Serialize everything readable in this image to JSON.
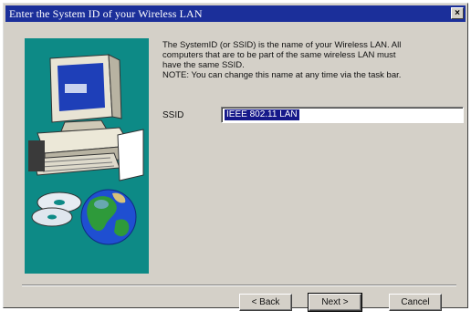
{
  "window": {
    "title": "Enter the System ID of your Wireless LAN",
    "close_label": "×"
  },
  "description": {
    "line1": "The SystemID (or SSID) is the name of your Wireless LAN. All",
    "line2": "computers that are to be part of the same wireless LAN must",
    "line3": "have the same SSID.",
    "line4": "NOTE: You can change this name at any time via the task bar."
  },
  "ssid": {
    "label": "SSID",
    "value": "IEEE 802.11 LAN"
  },
  "buttons": {
    "back": "< Back",
    "next": "Next >",
    "cancel": "Cancel"
  },
  "colors": {
    "titlebar": "#1b2f9a",
    "art_panel": "#0d8a86",
    "selection": "#16198a"
  }
}
